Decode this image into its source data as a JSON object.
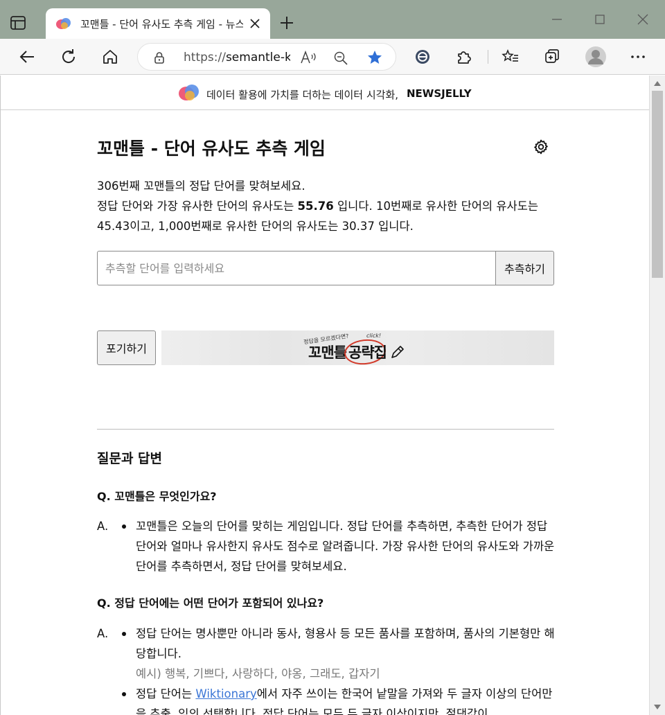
{
  "browser": {
    "tab_title": "꼬맨틀 - 단어 유사도 추측 게임 - 뉴스젤리",
    "url_prefix": "https://",
    "url_host": "semantle-ko.newsjelly.io"
  },
  "banner": {
    "text": "데이터 활용에 가치를 더하는 데이터 시각화,",
    "brand": "NEWSJELLY"
  },
  "game": {
    "title": "꼬맨틀 - 단어 유사도 추측 게임",
    "intro_line1": "306번째 꼬맨틀의 정답 단어를 맞혀보세요.",
    "intro_line2_a": "정답 단어와 가장 유사한 단어의 유사도는 ",
    "top_similarity": "55.76",
    "intro_line2_b": " 입니다. 10번째로 유사한 단어의 유사도는 45.43이고, 1,000번째로 유사한 단어의 유사도는 30.37 입니다.",
    "input_placeholder": "추측할 단어를 입력하세요",
    "guess_label": "추측하기",
    "giveup_label": "포기하기"
  },
  "ad": {
    "small_text": "정답을 모르겠다면?",
    "click_text": "click!",
    "title_part1": "꼬맨틀",
    "title_part2": "공략집"
  },
  "faq": {
    "heading": "질문과 답변",
    "answer_mark": "A.",
    "items": [
      {
        "question": "Q. 꼬맨틀은 무엇인가요?",
        "answers": [
          "꼬맨틀은 오늘의 단어를 맞히는 게임입니다. 정답 단어를 추측하면, 추측한 단어가 정답 단어와 얼마나 유사한지 유사도 점수로 알려줍니다. 가장 유사한 단어의 유사도와 가까운 단어를 추측하면서, 정답 단어를 맞혀보세요."
        ]
      },
      {
        "question": "Q. 정답 단어에는 어떤 단어가 포함되어 있나요?",
        "answers": [
          "정답 단어는 명사뿐만 아니라 동사, 형용사 등 모든 품사를 포함하며, 품사의 기본형만 해당합니다."
        ],
        "example": "예시) 행복, 기쁘다, 사랑하다, 야옹, 그래도, 갑자기",
        "answer2_a": "정답 단어는 ",
        "answer2_link": "Wiktionary",
        "answer2_b": "에서 자주 쓰이는 한국어 낱말을 가져와 두 글자 이상의 단어만을 추출, 임의 선택합니다. 정답 단어는 모두 두 글자 이상이지만, 절댓값이"
      }
    ]
  },
  "colors": {
    "tabbar": "#98a79a",
    "accent_star": "#2f6fd6",
    "link": "#3b76d6"
  }
}
